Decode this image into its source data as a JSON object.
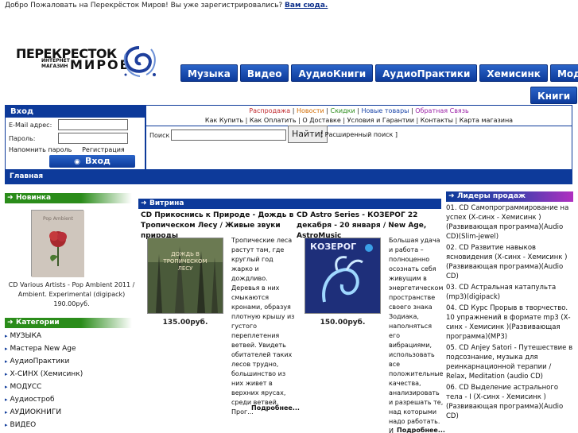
{
  "welcome": {
    "text": "Добро Пожаловать на Перекрёсток Миров! Вы уже зарегистрировались? ",
    "link": "Вам сюда."
  },
  "logo": {
    "line1": "ПЕРЕКРЕСТОК",
    "line2a": "ИНТЕРНЕТ",
    "line2b": "МАГАЗИН",
    "line3": "МИРОВ"
  },
  "nav": {
    "items": [
      "Музыка",
      "Видео",
      "АудиоКниги",
      "АудиоПрактики",
      "Хемисинк",
      "Модусс"
    ],
    "books": "Книги"
  },
  "login": {
    "title": "Вход",
    "email_label": "E-Mail адрес:",
    "password_label": "Пароль:",
    "remind": "Напомнить пароль",
    "register": "Регистрация",
    "submit": "Вход"
  },
  "toplinks": {
    "row1": [
      "Распродажа",
      "Новости",
      "Скидки",
      "Новые товары",
      "Обратная Связь"
    ],
    "row2": [
      "Как Купить",
      "Как Оплатить",
      "О Доставке",
      "Условия и Гарантии",
      "Контакты",
      "Карта магазина"
    ]
  },
  "search": {
    "label": "Поиск",
    "button": "Найти!",
    "advanced": "[ Расширенный поиск ]"
  },
  "breadcrumb": "Главная",
  "novinka": {
    "title": "Новинка",
    "text": "CD Various Artists - Pop Ambient 2011 / Ambient. Experimental (digipack) 190.00руб."
  },
  "categories": {
    "title": "Категории",
    "items": [
      "МУЗЫКА",
      "Мастера New Age",
      "АудиоПрактики",
      "Х-СИНХ (Хемисинк)",
      "МОДУСС",
      "Аудиостроб",
      "АУДИОКНИГИ",
      "ВИДЕО"
    ]
  },
  "vitrina": {
    "title": "Витрина",
    "products": [
      {
        "title": "CD Прикоснись к Природе - Дождь в Тропическом Лесу / Живые звуки природы",
        "price": "135.00руб.",
        "desc": "Тропические леса растут там, где круглый год жарко и дождливо. Деревья в них смыкаются кронами, образуя плотную крышу из густого переплетения ветвей. Увидеть обитателей таких лесов трудно, большинство из них живет в верхних ярусах, среди ветвей. Прог...",
        "more": "Подробнее..."
      },
      {
        "title": "CD Astro Series - КОЗЕРОГ 22 декабря - 20 января / New Age, AstroMusic",
        "price": "150.00руб.",
        "desc": "Большая удача и работа – полноценно осознать себя живущим в энергетическом пространстве своего знака Зодиака, наполняться его вибрациями, использовать все положительные качества, анализировать и разрешать те, над которыми надо работать. И периодическ...",
        "more": "Подробнее..."
      }
    ]
  },
  "leaders": {
    "title": "Лидеры продаж",
    "items": [
      "01. CD Самопрограммирование на успех (Х-синх - Хемисинк )(Развивающая программа)(Audio CD)(Slim-jewel)",
      "02. CD Развитие навыков ясновидения (Х-синх - Хемисинк )(Развивающая программа)(Audio CD)",
      "03. CD Астральная катапульта (mp3)(digipack)",
      "04. CD Курс Прорыв в творчество. 10 упражнений в формате mp3 (Х-синх - Хемисинк )(Развивающая программа)(MP3)",
      "05. CD Anjey Satori - Путешествие в подсознание, музыка для реинкарнационной терапии / Relax, Meditation (audio CD)",
      "06. CD Выделение астрального тела - I (Х-синх - Хемисинк )(Развивающая программа)(Audio CD)"
    ]
  },
  "colors": {
    "brand_blue": "#0d3a9a",
    "green": "#2a8c1a",
    "purple": "#b02fc0"
  }
}
